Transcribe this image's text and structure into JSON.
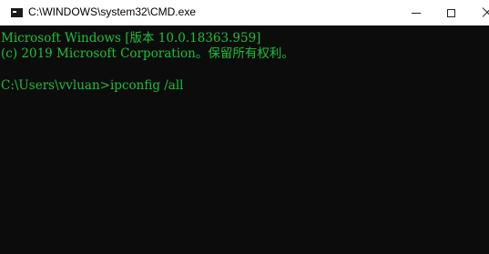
{
  "window": {
    "title": "C:\\WINDOWS\\system32\\CMD.exe",
    "icon": "cmd-icon",
    "controls": {
      "minimize_icon": "minimize-icon",
      "maximize_icon": "maximize-icon",
      "close_icon": "close-icon"
    }
  },
  "console": {
    "text_color": "#1fbf3a",
    "background": "#0c0c0c",
    "lines": [
      "Microsoft Windows [版本 10.0.18363.959]",
      "(c) 2019 Microsoft Corporation。保留所有权利。",
      "C:\\Users\\vvluan>ipconfig /all"
    ]
  }
}
